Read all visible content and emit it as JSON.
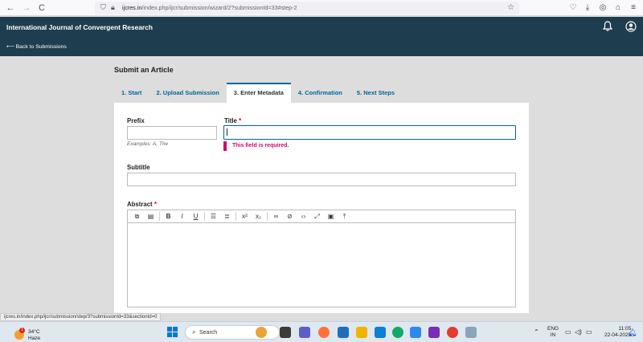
{
  "browser": {
    "back_glyph": "←",
    "forward_glyph": "→",
    "reload_glyph": "C",
    "url_host": "ijcres.in",
    "url_path": "/index.php/ijcr/submission/wizard/2?submissionId=33#step-2",
    "status_url": "ijcres.in/index.php/ijcr/submission/step/3?submissionId=33&sectionId=0",
    "icons": [
      "shield-icon",
      "lock-icon",
      "star-icon",
      "pocket-icon",
      "download-icon",
      "account-icon",
      "extensions-icon",
      "menu-icon"
    ]
  },
  "header": {
    "site_title": "International Journal of Convergent Research",
    "back_link": "⟵ Back to Submissions",
    "icons": [
      "bell-icon",
      "user-icon"
    ]
  },
  "page": {
    "title": "Submit an Article",
    "tabs": [
      "1. Start",
      "2. Upload Submission",
      "3. Enter Metadata",
      "4. Confirmation",
      "5. Next Steps"
    ],
    "active_tab": "3. Enter Metadata"
  },
  "form": {
    "prefix_label": "Prefix",
    "prefix_value": "",
    "prefix_hint": "Examples: A, The",
    "title_label": "Title",
    "title_value": "",
    "required_mark": "*",
    "title_error": "This field is required.",
    "subtitle_label": "Subtitle",
    "subtitle_value": "",
    "abstract_label": "Abstract",
    "abstract_value": ""
  },
  "editor_toolbar": {
    "buttons": [
      "copy",
      "paste",
      "bold",
      "italic",
      "underline",
      "bullet-list",
      "numbered-list",
      "superscript",
      "subscript",
      "link",
      "unlink",
      "code",
      "fullscreen",
      "image",
      "upload"
    ],
    "bold_glyph": "B",
    "italic_glyph": "I",
    "underline_glyph": "U"
  },
  "taskbar": {
    "temperature": "34°C",
    "weather": "Haze",
    "weather_badge": "1",
    "search_placeholder": "Search",
    "language": "ENG",
    "region": "IN",
    "time": "11:05",
    "date": "22-04-2025"
  },
  "colors": {
    "header_bg": "#1e3e4f",
    "link": "#006798",
    "error": "#d00a6c",
    "required": "#c40e0e"
  }
}
